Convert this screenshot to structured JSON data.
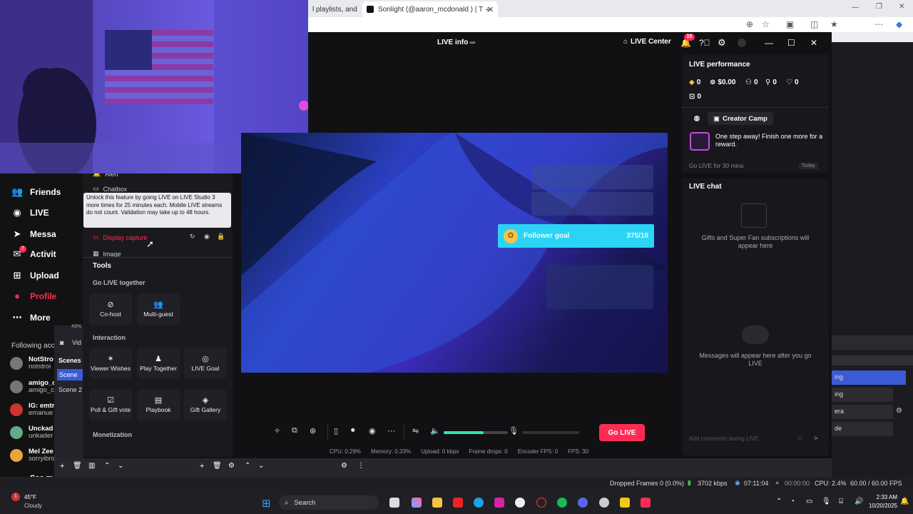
{
  "browser": {
    "tab1": "l playlists, and",
    "tab2": "Sonlight (@aaron_mcdonald ) | T",
    "new_tab": "+"
  },
  "tiktok_nav": [
    {
      "label": "Friends",
      "icon": "friends-icon"
    },
    {
      "label": "LIVE",
      "icon": "live-icon"
    },
    {
      "label": "Messa",
      "icon": "messages-icon"
    },
    {
      "label": "Activit",
      "icon": "activity-icon",
      "badge": "7"
    },
    {
      "label": "Upload",
      "icon": "upload-icon"
    },
    {
      "label": "Profile",
      "icon": "profile-icon"
    },
    {
      "label": "More",
      "icon": "more-icon"
    }
  ],
  "following": {
    "title": "Following acc",
    "items": [
      {
        "name": "NotStro",
        "handle": "notstroi"
      },
      {
        "name": "amigo_c",
        "handle": "amigo_c"
      },
      {
        "name": "IG: emtr",
        "handle": "emanue"
      },
      {
        "name": "Unckad",
        "handle": "unkader"
      },
      {
        "name": "Mel Zee",
        "handle": "sorryibro"
      }
    ],
    "see_more": "See mo"
  },
  "obs_left": {
    "zoom": "49%",
    "vid_label": "Vid",
    "scenes_title": "Scenes",
    "scene1": "Scene",
    "scene2": "Scene 2"
  },
  "sources": {
    "alert": "Alert",
    "chatbox": "Chatbox",
    "display_capture": "Display capture",
    "image": "Image"
  },
  "tooltip": "Unlock this feature by going LIVE on LIVE Studio 3 more times for 25 minutes each. Mobile LIVE streams do not count. Validation may take up to 48 hours.",
  "tools": {
    "title": "Tools",
    "go_live_together": "Go LIVE together",
    "cohost": "Co-host",
    "multiguest": "Multi-guest",
    "interaction": "Interaction",
    "viewer_wishes": "Viewer Wishes",
    "play_together": "Play Together",
    "live_goal": "LIVE Goal",
    "poll": "Poll & Gift vote",
    "playbook": "Playbook",
    "gift_gallery": "Gift Gallery",
    "monetization": "Monetization"
  },
  "header": {
    "live_info": "LIVE info",
    "live_center": "LIVE Center",
    "notif_count": "10"
  },
  "preview": {
    "follower_goal_label": "Follower goal",
    "follower_goal_value": "375/10"
  },
  "controls": {
    "go_live": "Go LIVE",
    "volume_level": 0.62
  },
  "stats": {
    "cpu": "CPU: 0.29%",
    "memory": "Memory: 0.33%",
    "upload": "Upload: 0 kbps",
    "frame_drops": "Frame drops: 0",
    "encoder_fps": "Encoder FPS: 0",
    "fps": "FPS: 30"
  },
  "performance": {
    "title": "LIVE performance",
    "diamonds": "0",
    "earnings": "$0.00",
    "viewers": "0",
    "new_followers": "0",
    "likes": "0",
    "gifts": "0",
    "creator_camp": "Creator Camp",
    "reward_text": "One step away! Finish one more for a reward.",
    "task": "Go LIVE for 30 mins",
    "task_when": "Today"
  },
  "chat": {
    "title": "LIVE chat",
    "gifts_note": "Gifts and Super Fan subscriptions will appear here",
    "messages_note": "Messages will appear here after you go LIVE",
    "input_placeholder": "Add comments during LIVE"
  },
  "obs_right": {
    "items": [
      "ing",
      "ing",
      "era",
      "de"
    ]
  },
  "status_bar": {
    "dropped": "Dropped Frames 0 (0.0%)",
    "bitrate": "3702 kbps",
    "live_time": "07:11:04",
    "rec_time": "00:00:00",
    "cpu": "CPU: 2.4%",
    "fps": "60.00 / 60.00 FPS"
  },
  "taskbar": {
    "temp": "45°F",
    "weather": "Cloudy",
    "search": "Search",
    "time": "2:33 AM",
    "date": "10/20/2025"
  }
}
